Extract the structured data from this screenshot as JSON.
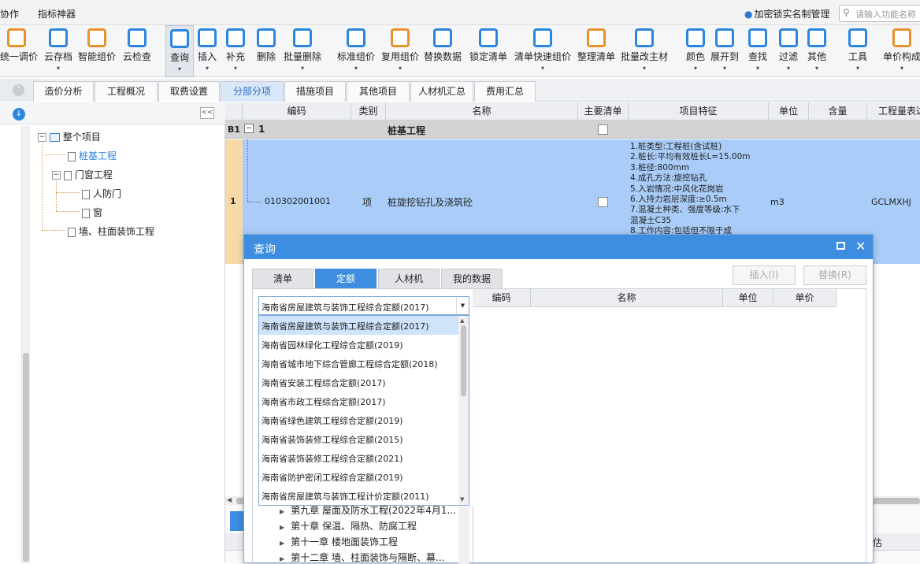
{
  "menu": {
    "items": [
      "协作",
      "指标神器"
    ],
    "user": "加密锁实名制管理",
    "search_placeholder": "请输入功能名称"
  },
  "toolbar": {
    "buttons": [
      {
        "label": "统一调价",
        "icon": "unify-price-icon",
        "color": "#e8912b"
      },
      {
        "label": "云存档",
        "icon": "cloud-upload-icon",
        "color": "#2b86e0"
      },
      {
        "label": "智能组价",
        "icon": "smart-price-icon",
        "color": "#e8912b"
      },
      {
        "label": "云检查",
        "icon": "cloud-check-icon",
        "color": "#2b86e0"
      },
      {
        "label": "查询",
        "icon": "query-icon",
        "color": "#2b86e0"
      },
      {
        "label": "插入",
        "icon": "insert-icon",
        "color": "#2b86e0"
      },
      {
        "label": "补充",
        "icon": "supplement-icon",
        "color": "#2b86e0"
      },
      {
        "label": "删除",
        "icon": "delete-icon",
        "color": "#2b86e0"
      },
      {
        "label": "批量删除",
        "icon": "batch-delete-icon",
        "color": "#2b86e0"
      },
      {
        "label": "标准组价",
        "icon": "standard-price-icon",
        "color": "#2b86e0"
      },
      {
        "label": "复用组价",
        "icon": "reuse-price-icon",
        "color": "#e8912b"
      },
      {
        "label": "替换数据",
        "icon": "replace-data-icon",
        "color": "#2b86e0"
      },
      {
        "label": "锁定清单",
        "icon": "lock-list-icon",
        "color": "#2b86e0"
      },
      {
        "label": "清单快速组价",
        "icon": "quick-price-icon",
        "color": "#2b86e0"
      },
      {
        "label": "整理清单",
        "icon": "organize-list-icon",
        "color": "#e8912b"
      },
      {
        "label": "批量改主材",
        "icon": "batch-material-icon",
        "color": "#2b86e0"
      },
      {
        "label": "颜色",
        "icon": "color-bucket-icon",
        "color": "#2b86e0"
      },
      {
        "label": "展开到",
        "icon": "expand-to-icon",
        "color": "#2b86e0"
      },
      {
        "label": "查找",
        "icon": "find-icon",
        "color": "#2b86e0"
      },
      {
        "label": "过滤",
        "icon": "filter-icon",
        "color": "#2b86e0"
      },
      {
        "label": "其他",
        "icon": "other-icon",
        "color": "#2b86e0"
      },
      {
        "label": "工具",
        "icon": "tools-icon",
        "color": "#2b86e0"
      },
      {
        "label": "单价构成",
        "icon": "unit-price-icon",
        "color": "#e8912b"
      }
    ]
  },
  "tabs": [
    "造价分析",
    "工程概况",
    "取费设置",
    "分部分项",
    "措施项目",
    "其他项目",
    "人材机汇总",
    "费用汇总"
  ],
  "tree": {
    "root": "整个项目",
    "nodes": [
      "桩基工程",
      "门窗工程",
      "人防门",
      "窗",
      "墙、柱面装饰工程"
    ]
  },
  "grid": {
    "headers": [
      "编码",
      "类别",
      "名称",
      "主要清单",
      "项目特征",
      "单位",
      "含量",
      "工程量表达"
    ],
    "row_b1": {
      "code": "B1",
      "num": "1",
      "name": "桩基工程"
    },
    "row1": {
      "index": "1",
      "code": "010302001001",
      "type": "项",
      "name": "桩旋挖钻孔及浇筑砼",
      "unit": "m3",
      "expr": "GCLMXHJ",
      "features": [
        "1.桩类型:工程桩(含试桩)",
        "2.桩长:平均有效桩长L=15.00m",
        "3.桩径:800mm",
        "4.成孔方法:旋挖钻孔",
        "5.入岩情况:中风化花岗岩",
        "6.入持力岩层深度:≥0.5m",
        "7.混凝土种类、强度等级:水下",
        "混凝土C35",
        "8.工作内容:包括但不限于成"
      ]
    },
    "bottom_right": "估"
  },
  "dialog": {
    "title": "查询",
    "tabs": [
      "清单",
      "定额",
      "人材机",
      "我的数据"
    ],
    "insert_label": "插入(I)",
    "replace_label": "替换(R)",
    "selected": "海南省房屋建筑与装饰工程综合定额(2017)",
    "options": [
      "海南省房屋建筑与装饰工程综合定额(2017)",
      "海南省园林绿化工程综合定额(2019)",
      "海南省城市地下综合管廊工程综合定额(2018)",
      "海南省安装工程综合定额(2017)",
      "海南省市政工程综合定额(2017)",
      "海南省绿色建筑工程综合定额(2019)",
      "海南省装饰装修工程综合定额(2015)",
      "海南省装饰装修工程综合定额(2021)",
      "海南省防护密闭工程综合定额(2019)",
      "海南省房屋建筑与装饰工程计价定额(2011)"
    ],
    "result_headers": [
      "编码",
      "名称",
      "单位",
      "单价"
    ],
    "chapters": [
      "第九章 屋面及防水工程(2022年4月1...",
      "第十章 保温、隔热、防腐工程",
      "第十一章 楼地面装饰工程",
      "第十二章 墙、柱面装饰与隔断、幕..."
    ]
  }
}
